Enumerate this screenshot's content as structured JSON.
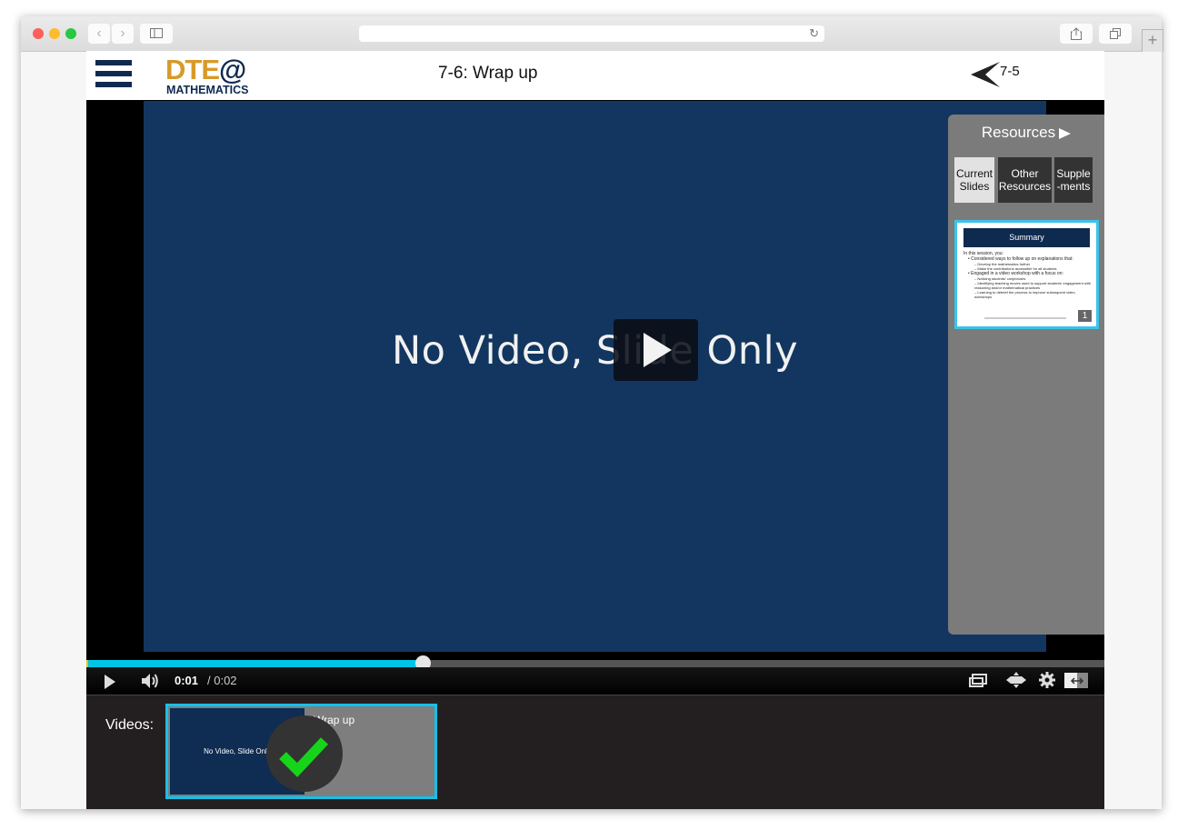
{
  "browser": {
    "buttons": {
      "back": "‹",
      "forward": "›",
      "new_tab": "+"
    }
  },
  "header": {
    "logo_top": "DTE",
    "logo_at": "@",
    "logo_bottom": "MATHEMATICS",
    "title": "7-6: Wrap up",
    "prev_label": "7-5"
  },
  "slide": {
    "text": "No Video, Slide Only"
  },
  "resources": {
    "title": "Resources",
    "tabs": [
      {
        "label": "Current Slides",
        "active": true
      },
      {
        "label": "Other Resources",
        "active": false
      },
      {
        "label": "Supple -ments",
        "active": false
      }
    ],
    "thumbnail": {
      "heading": "Summary",
      "intro": "In this session, you:",
      "bullets": [
        {
          "text": "Considered ways to follow up on explanations that:",
          "subs": [
            "Develop the mathematics further",
            "Make the contributions accessible for all students"
          ]
        },
        {
          "text": "Engaged in a video workshop with a focus on:",
          "subs": [
            "Noticing students' conjectures",
            "Identifying teaching moves used to support students' engagement with reasoning and/or mathematical practices",
            "Learning to debrief the process to improve subsequent video workshops"
          ]
        }
      ],
      "page_number": "1"
    }
  },
  "player": {
    "current_time": "0:01",
    "total_time": "/ 0:02",
    "progress_fraction": 0.33,
    "accent_color": "#00c4e8"
  },
  "videos": {
    "label": "Videos:",
    "items": [
      {
        "thumb_text": "No Video, Slide Only",
        "title": "Wrap up",
        "completed": true
      }
    ]
  }
}
